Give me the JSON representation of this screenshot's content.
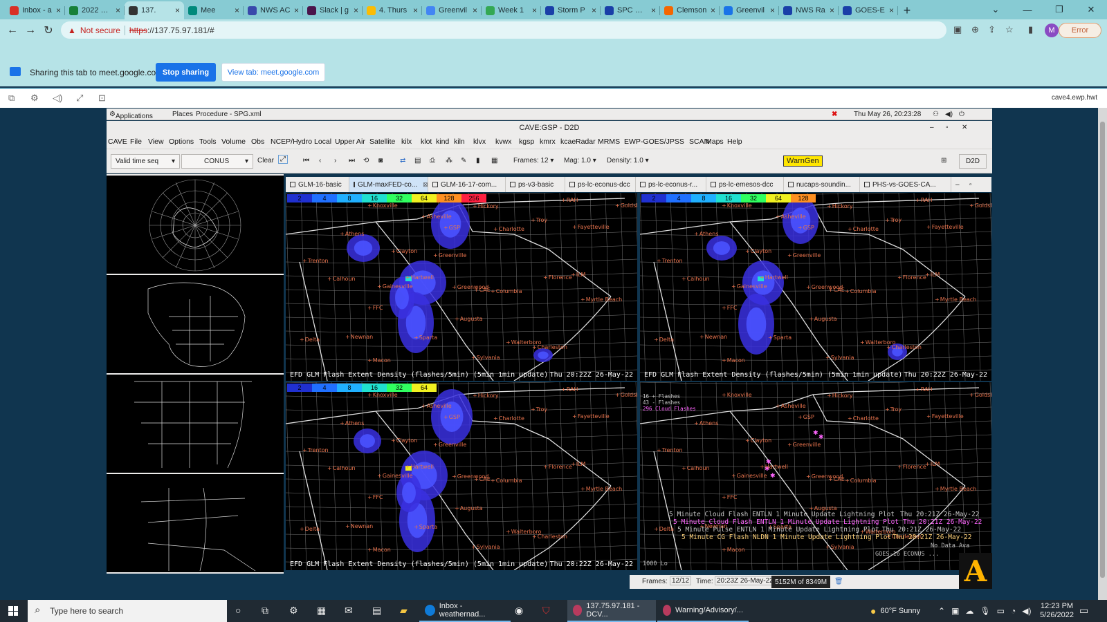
{
  "browser": {
    "tabs": [
      {
        "title": "Inbox - a",
        "color": "#d93025"
      },
      {
        "title": "2022 HW",
        "color": "#188038"
      },
      {
        "title": "137.",
        "color": "#333333",
        "active": true
      },
      {
        "title": "Mee",
        "color": "#00897b"
      },
      {
        "title": "NWS AC",
        "color": "#3949ab"
      },
      {
        "title": "Slack | g",
        "color": "#4a154b"
      },
      {
        "title": "4. Thurs",
        "color": "#fbbc04"
      },
      {
        "title": "Greenvil",
        "color": "#4285f4"
      },
      {
        "title": "Week 1",
        "color": "#34a853"
      },
      {
        "title": "Storm P",
        "color": "#1a3fa8"
      },
      {
        "title": "SPC HRE",
        "color": "#1a3fa8"
      },
      {
        "title": "Clemson",
        "color": "#f56600"
      },
      {
        "title": "Greenvil",
        "color": "#1a73e8"
      },
      {
        "title": "NWS Ra",
        "color": "#1a3fa8"
      },
      {
        "title": "GOES-E",
        "color": "#1a3fa8"
      }
    ],
    "new_tab": "+",
    "security_label": "Not secure",
    "url_scheme": "https",
    "url_rest": "://137.75.97.181/#",
    "profile_initial": "M",
    "error_label": "Error"
  },
  "sharing": {
    "message": "Sharing this tab to meet.google.com",
    "stop_label": "Stop sharing",
    "view_label": "View tab: meet.google.com"
  },
  "remote": {
    "host": "cave4.ewp.hwt"
  },
  "gnome": {
    "applications": "Applications",
    "places": "Places",
    "procedure": "Procedure - SPG.xml",
    "datetime": "Thu May 26, 20:23:28"
  },
  "cave": {
    "title": "CAVE:GSP - D2D",
    "menus": [
      "CAVE",
      "File",
      "View",
      "Options",
      "Tools",
      "Volume",
      "Obs",
      "NCEP/Hydro",
      "Local",
      "Upper Air",
      "Satellite",
      "kilx",
      "klot",
      "kind",
      "kiln",
      "klvx",
      "kvwx",
      "kgsp",
      "kmrx",
      "kcae",
      "Radar",
      "MRMS",
      "EWP-GOES/JPSS",
      "SCAN",
      "Maps",
      "Help"
    ],
    "toolbar": {
      "time_mode": "Valid time seq",
      "scale": "CONUS",
      "clear": "Clear",
      "frames": "Frames: 12",
      "mag": "Mag: 1.0",
      "density": "Density: 1.0",
      "warngen": "WarnGen",
      "perspective": "D2D"
    },
    "panel_tabs": [
      "GLM-16-basic",
      "GLM-maxFED-co...",
      "GLM-16-17-com...",
      "ps-v3-basic",
      "ps-lc-econus-dcc",
      "ps-lc-econus-r...",
      "ps-lc-emesos-dcc",
      "nucaps-soundin...",
      "PHS-vs-GOES-CA..."
    ],
    "colorbar_top": [
      "2",
      "4",
      "8",
      "16",
      "32",
      "64",
      "128",
      "256"
    ],
    "colorbar_top_right": [
      "2",
      "4",
      "8",
      "16",
      "32",
      "64",
      "128"
    ],
    "colorbar_bottom": [
      "2",
      "4",
      "8",
      "16",
      "32",
      "64"
    ],
    "caption_left": "EFD GLM Flash Extent Density (flashes/5min) (5min 1min update)",
    "caption_time": "Thu 20:22Z 26-May-22",
    "lightning_counts": [
      "16 + Flashes",
      "43 - Flashes",
      "296 Cloud Flashes"
    ],
    "lightning_lines": [
      {
        "text": "5 Minute Cloud Flash ENTLN 1 Minute Update Lightning Plot",
        "time": "Thu 20:21Z 26-May-22",
        "color": "#c7c7c7"
      },
      {
        "text": "5 Minute Cloud Flash ENTLN 1 Minute Update Lightning Plot",
        "time": "Thu 20:21Z 26-May-22",
        "color": "#ff66ff"
      },
      {
        "text": "5 Minute Pulse ENTLN 1 Minute Update Lightning Plot",
        "time": "Thu 20:21Z 26-May-22",
        "color": "#c7c7c7"
      },
      {
        "text": "5 Minute CG Flash NLDN 1 Minute Update Lightning Plot",
        "time": "Thu 20:21Z 26-May-22",
        "color": "#ffd27a"
      }
    ],
    "lightning_tail": [
      "No Data Ava",
      "GOES-16 ECONUS ...",
      "1000 Lo"
    ],
    "cities": [
      {
        "name": "Knoxville"
      },
      {
        "name": "Hickory"
      },
      {
        "name": "Asheville"
      },
      {
        "name": "GSP"
      },
      {
        "name": "Charlotte"
      },
      {
        "name": "Troy"
      },
      {
        "name": "Fayetteville"
      },
      {
        "name": "Athens"
      },
      {
        "name": "Clayton"
      },
      {
        "name": "Greenville"
      },
      {
        "name": "Hartwell"
      },
      {
        "name": "Gainesville"
      },
      {
        "name": "Greenwood"
      },
      {
        "name": "CAE"
      },
      {
        "name": "Columbia"
      },
      {
        "name": "Florence"
      },
      {
        "name": "ILM"
      },
      {
        "name": "Myrtle Beach"
      },
      {
        "name": "Augusta"
      },
      {
        "name": "Sparta"
      },
      {
        "name": "Trenton"
      },
      {
        "name": "Calhoun"
      },
      {
        "name": "Walterboro"
      },
      {
        "name": "Charleston"
      },
      {
        "name": "Sylvania"
      },
      {
        "name": "Macon"
      },
      {
        "name": "Delta"
      },
      {
        "name": "Newnan"
      },
      {
        "name": "FFC"
      },
      {
        "name": "RAH"
      },
      {
        "name": "Goldsb"
      }
    ],
    "status": {
      "frames_label": "Frames:",
      "frames_value": "12/12",
      "time_label": "Time:",
      "time_value": "20:23Z 26-May-22",
      "memory": "5152M of 8349M"
    }
  },
  "taskbar": {
    "search_placeholder": "Type here to search",
    "apps": [
      {
        "label": "Inbox - weathernad...",
        "color": "#0f7bd8"
      },
      {
        "label": "137.75.97.181 - DCV...",
        "color": "#b83b5e"
      },
      {
        "label": "Warning/Advisory/...",
        "color": "#b83b5e"
      }
    ],
    "weather": "60°F  Sunny",
    "time": "12:23 PM",
    "date": "5/26/2022"
  }
}
